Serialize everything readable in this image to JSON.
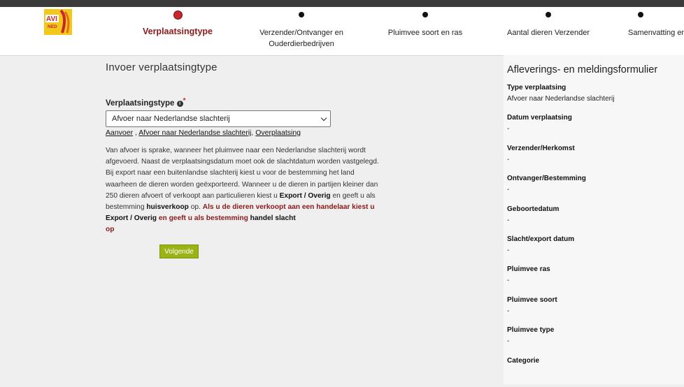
{
  "logo": {
    "text_top": "AVI",
    "text_bottom": "NED"
  },
  "steps": [
    {
      "label": "Verplaatsingtype",
      "active": true
    },
    {
      "label": "Verzender/Ontvanger en Ouderdierbedrijven",
      "active": false
    },
    {
      "label": "Pluimvee soort en ras",
      "active": false
    },
    {
      "label": "Aantal dieren Verzender",
      "active": false
    },
    {
      "label": "Samenvatting en b",
      "active": false
    }
  ],
  "main": {
    "heading": "Invoer verplaatsingtype",
    "field_label": "Verplaatsingstype",
    "info_icon": "i",
    "required_mark": "*",
    "select_value": "Afvoer naar Nederlandse slachterij",
    "links": [
      {
        "label": "Aanvoer"
      },
      {
        "label": "Afvoer naar Nederlandse slachterij"
      },
      {
        "label": "Overplaatsing"
      }
    ],
    "description": {
      "p1": "Van afvoer is sprake, wanneer het pluimvee naar een Nederlandse slachterij wordt afgevoerd. Naast de verplaatsingsdatum moet ook de slachtdatum worden vastgelegd. Bij export naar een buitenlandse slachterij kiest u voor de bestemming het land waarheen de dieren worden geëxporteerd. Wanneer u de dieren in partijen kleiner dan 250 dieren afvoert of verkoopt aan particulieren kiest u ",
      "b1": "Export / Overig",
      "p2": " en geeft u als bestemming ",
      "b2": "huisverkoop",
      "p3": " op. ",
      "r1": "Als u de dieren verkoopt aan een handelaar kiest u ",
      "b3": "Export / Overig",
      "r2": " en geeft u als bestemming ",
      "b4": "handel slacht",
      "r3": " op"
    },
    "next_button": "Volgende"
  },
  "sidebar": {
    "title": "Afleverings- en meldingsformulier",
    "items": [
      {
        "key": "Type verplaatsing",
        "value": "Afvoer naar Nederlandse slachterij"
      },
      {
        "key": "Datum verplaatsing",
        "value": "-"
      },
      {
        "key": "Verzender/Herkomst",
        "value": "-"
      },
      {
        "key": "Ontvanger/Bestemming",
        "value": "-"
      },
      {
        "key": "Geboortedatum",
        "value": "-"
      },
      {
        "key": "Slacht/export datum",
        "value": "-"
      },
      {
        "key": "Pluimvee ras",
        "value": "-"
      },
      {
        "key": "Pluimvee soort",
        "value": "-"
      },
      {
        "key": "Pluimvee type",
        "value": "-"
      },
      {
        "key": "Categorie",
        "value": ""
      }
    ]
  },
  "colors": {
    "accent_red": "#8b1a1a",
    "active_dot": "#c8262e",
    "button_green": "#9bb314",
    "logo_yellow": "#f2c81a"
  }
}
